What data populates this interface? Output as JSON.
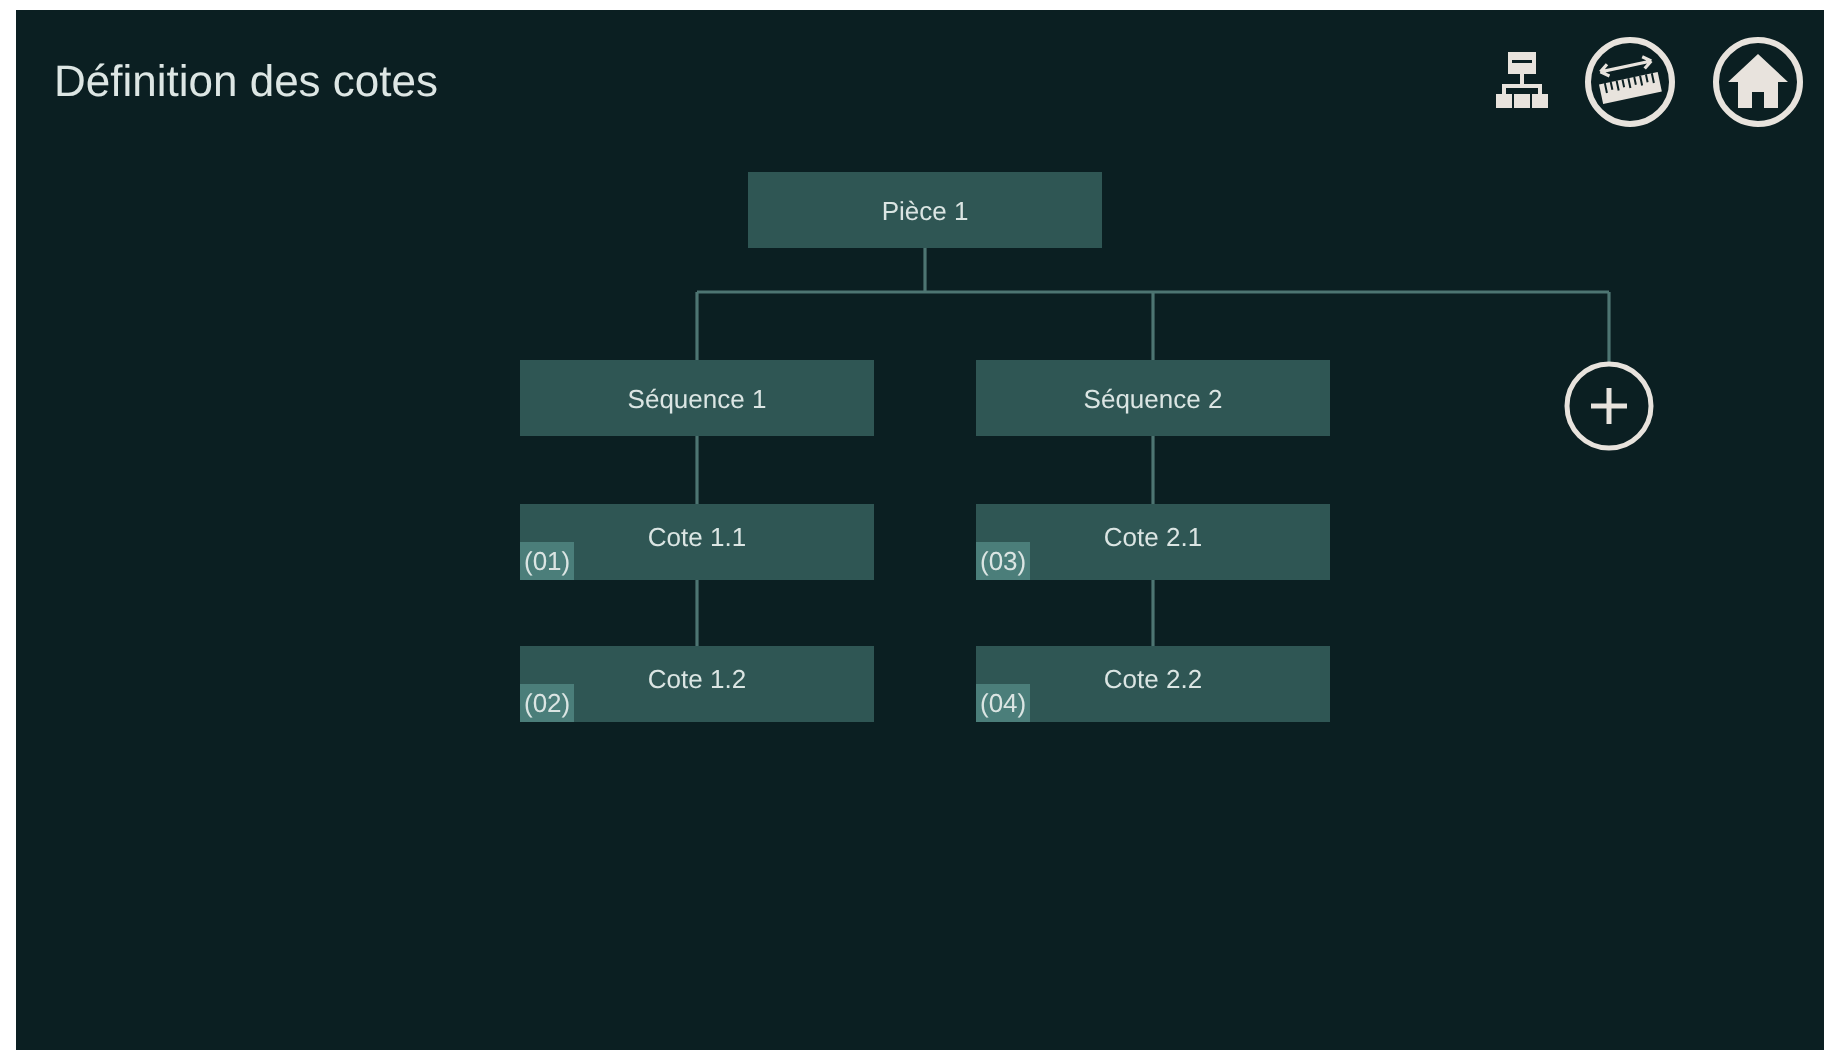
{
  "screen": {
    "title": "Définition des cotes"
  },
  "tree": {
    "label": "Pièce 1",
    "children": [
      {
        "label": "Séquence 1",
        "children": [
          {
            "label": "Cote 1.1",
            "number": "(01)"
          },
          {
            "label": "Cote 1.2",
            "number": "(02)"
          }
        ]
      },
      {
        "label": "Séquence 2",
        "children": [
          {
            "label": "Cote 2.1",
            "number": "(03)"
          },
          {
            "label": "Cote 2.2",
            "number": "(04)"
          }
        ]
      }
    ]
  }
}
